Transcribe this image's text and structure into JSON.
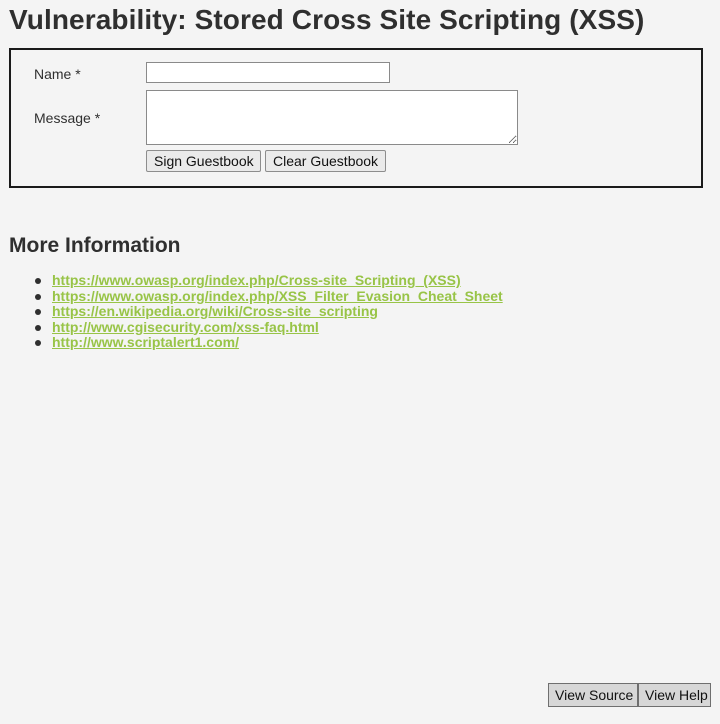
{
  "header": {
    "title": "Vulnerability: Stored Cross Site Scripting (XSS)"
  },
  "form": {
    "name_label": "Name *",
    "name_value": "",
    "message_label": "Message *",
    "message_value": "",
    "sign_button": "Sign Guestbook",
    "clear_button": "Clear Guestbook"
  },
  "more_info": {
    "title": "More Information",
    "links": [
      "https://www.owasp.org/index.php/Cross-site_Scripting_(XSS)",
      "https://www.owasp.org/index.php/XSS_Filter_Evasion_Cheat_Sheet",
      "https://en.wikipedia.org/wiki/Cross-site_scripting",
      "http://www.cgisecurity.com/xss-faq.html",
      "http://www.scriptalert1.com/"
    ]
  },
  "footer": {
    "view_source": "View Source",
    "view_help": "View Help"
  },
  "colors": {
    "background": "#f4f4f4",
    "text": "#2f2f2f",
    "link": "#98c447",
    "form_border": "#1a1a1a"
  }
}
